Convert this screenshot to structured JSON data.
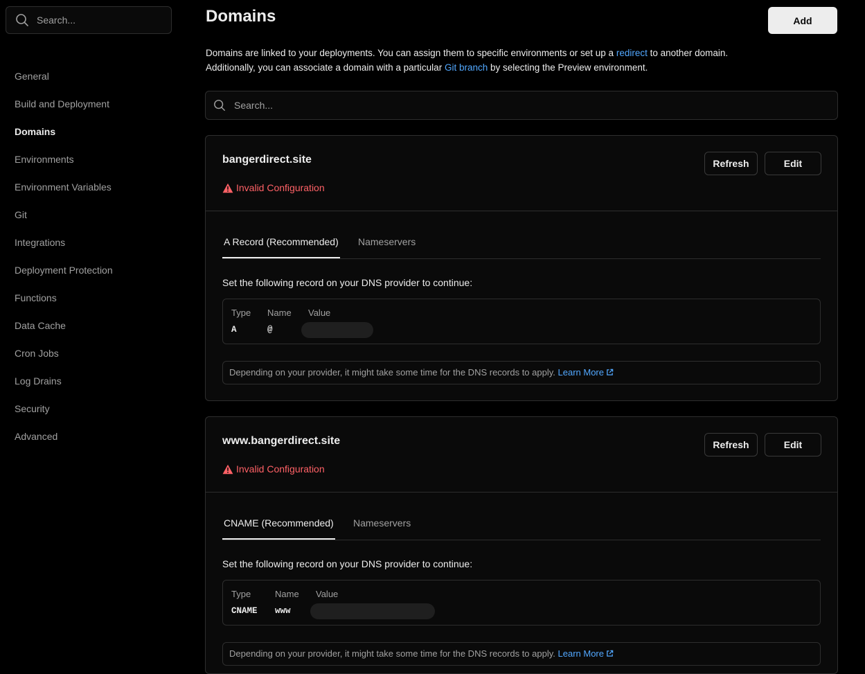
{
  "sidebar": {
    "search_placeholder": "Search...",
    "items": [
      {
        "label": "General"
      },
      {
        "label": "Build and Deployment"
      },
      {
        "label": "Domains"
      },
      {
        "label": "Environments"
      },
      {
        "label": "Environment Variables"
      },
      {
        "label": "Git"
      },
      {
        "label": "Integrations"
      },
      {
        "label": "Deployment Protection"
      },
      {
        "label": "Functions"
      },
      {
        "label": "Data Cache"
      },
      {
        "label": "Cron Jobs"
      },
      {
        "label": "Log Drains"
      },
      {
        "label": "Security"
      },
      {
        "label": "Advanced"
      }
    ],
    "active": "Domains"
  },
  "header": {
    "title": "Domains",
    "add_label": "Add"
  },
  "intro": {
    "part1": "Domains are linked to your deployments. You can assign them to specific environments or set up a ",
    "link1": "redirect",
    "part2": " to another domain.",
    "part3": "Additionally, you can associate a domain with a particular ",
    "link2": "Git branch",
    "part4": " by selecting the Preview environment."
  },
  "domain_search": {
    "placeholder": "Search..."
  },
  "domains": [
    {
      "name": "bangerdirect.site",
      "status": "Invalid Configuration",
      "refresh_label": "Refresh",
      "edit_label": "Edit",
      "tabs": [
        {
          "label": "A Record (Recommended)"
        },
        {
          "label": "Nameservers"
        }
      ],
      "active_tab": 0,
      "instruction": "Set the following record on your DNS provider to continue:",
      "record_headers": {
        "type": "Type",
        "name": "Name",
        "value": "Value"
      },
      "record": {
        "type": "A",
        "name": "@"
      },
      "note": "Depending on your provider, it might take some time for the DNS records to apply.",
      "note_link": "Learn More"
    },
    {
      "name": "www.bangerdirect.site",
      "status": "Invalid Configuration",
      "refresh_label": "Refresh",
      "edit_label": "Edit",
      "tabs": [
        {
          "label": "CNAME (Recommended)"
        },
        {
          "label": "Nameservers"
        }
      ],
      "active_tab": 0,
      "instruction": "Set the following record on your DNS provider to continue:",
      "record_headers": {
        "type": "Type",
        "name": "Name",
        "value": "Value"
      },
      "record": {
        "type": "CNAME",
        "name": "www"
      },
      "note": "Depending on your provider, it might take some time for the DNS records to apply.",
      "note_link": "Learn More"
    }
  ],
  "colors": {
    "background": "#000000",
    "card": "#0a0a0a",
    "border": "#2e2e2e",
    "link": "#52a8ff",
    "error": "#ff6166"
  },
  "icons": {
    "search": "search-icon",
    "warning": "warning-triangle-icon",
    "external_link": "external-link-icon"
  }
}
